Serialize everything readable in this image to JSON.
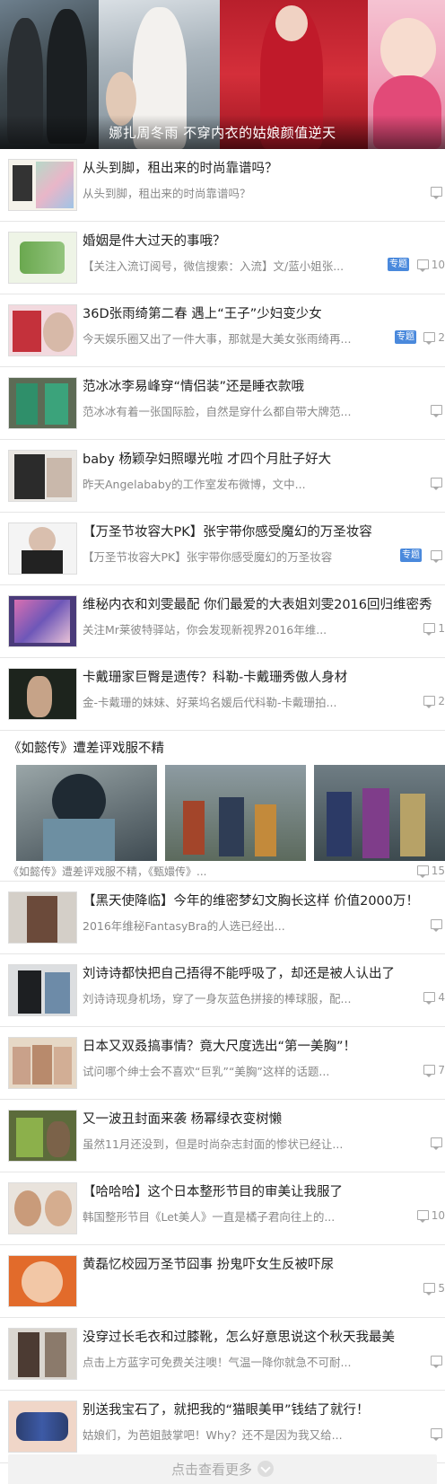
{
  "hero": {
    "caption": "娜扎周冬雨 不穿内衣的姑娘颜值逆天"
  },
  "items": [
    {
      "title": "从头到脚，租出来的时尚靠谱吗？",
      "desc": "从头到脚，租出来的时尚靠谱吗？",
      "badge": "",
      "comments": ""
    },
    {
      "title": "婚姻是件大过天的事哦？",
      "desc": "【关注入流订阅号，微信搜索：入流】文/蓝小姐张...",
      "badge": "专题",
      "comments": "10"
    },
    {
      "title": "36D张雨绮第二春 遇上“王子”少妇变少女",
      "desc": "今天娱乐圈又出了一件大事，那就是大美女张雨绮再...",
      "badge": "专题",
      "comments": "2"
    },
    {
      "title": "范冰冰李易峰穿“情侣装”还是睡衣款哦",
      "desc": "范冰冰有着一张国际脸，自然是穿什么都自带大牌范...",
      "badge": "",
      "comments": ""
    },
    {
      "title": "baby 杨颖孕妇照曝光啦 才四个月肚子好大",
      "desc": "昨天Angelababy的工作室发布微博，文中...",
      "badge": "",
      "comments": ""
    },
    {
      "title": "【万圣节妆容大PK】张宇带你感受魔幻的万圣妆容",
      "desc": "【万圣节妆容大PK】张宇带你感受魔幻的万圣妆容",
      "badge": "专题",
      "comments": ""
    },
    {
      "title": "维秘内衣和刘雯最配 你们最爱的大表姐刘雯2016回归维密秀",
      "desc": "关注Mr莱彼特驿站，你会发现新视界2016年维...",
      "badge": "",
      "comments": "1"
    },
    {
      "title": "卡戴珊家巨臀是遗传？科勒-卡戴珊秀傲人身材",
      "desc": "金-卡戴珊的妹妹、好莱坞名媛后代科勒-卡戴珊拍...",
      "badge": "",
      "comments": "2"
    }
  ],
  "gallery": {
    "title": "《如懿传》遭差评戏服不精",
    "desc": "《如懿传》遭差评戏服不精，《甄嬛传》...",
    "comments": "15"
  },
  "items2": [
    {
      "title": "【黑天使降临】今年的维密梦幻文胸长这样 价值2000万！",
      "desc": "2016年维秘FantasyBra的人选已经出...",
      "comments": ""
    },
    {
      "title": "刘诗诗都快把自己捂得不能呼吸了，却还是被人认出了",
      "desc": "刘诗诗现身机场，穿了一身灰蓝色拼接的棒球服，配...",
      "comments": "4"
    },
    {
      "title": "日本又双叒搞事情？竟大尺度选出“第一美胸”！",
      "desc": "试问哪个绅士会不喜欢“巨乳”“美胸”这样的话题...",
      "comments": "7"
    },
    {
      "title": "又一波丑封面来袭 杨幂绿衣变树懒",
      "desc": "虽然11月还没到，但是时尚杂志封面的惨状已经让...",
      "comments": ""
    },
    {
      "title": "【哈哈哈】这个日本整形节目的审美让我服了",
      "desc": "韩国整形节目《Let美人》一直是橘子君向往上的...",
      "comments": "10"
    },
    {
      "title": "黄磊忆校园万圣节囧事 扮鬼吓女生反被吓尿",
      "desc": "",
      "comments": "5"
    },
    {
      "title": "没穿过长毛衣和过膝靴，怎么好意思说这个秋天我最美",
      "desc": "点击上方蓝字可免费关注噢！气温一降你就急不可耐...",
      "comments": ""
    },
    {
      "title": "别送我宝石了，就把我的“猫眼美甲”钱结了就行！",
      "desc": "姑娘们，为芭姐鼓掌吧！Why？还不是因为我又给...",
      "comments": ""
    }
  ],
  "load_more": "点击查看更多",
  "colors": {
    "badge": "#4a89dc",
    "divider": "#e6e6e6",
    "desc": "#888888"
  }
}
